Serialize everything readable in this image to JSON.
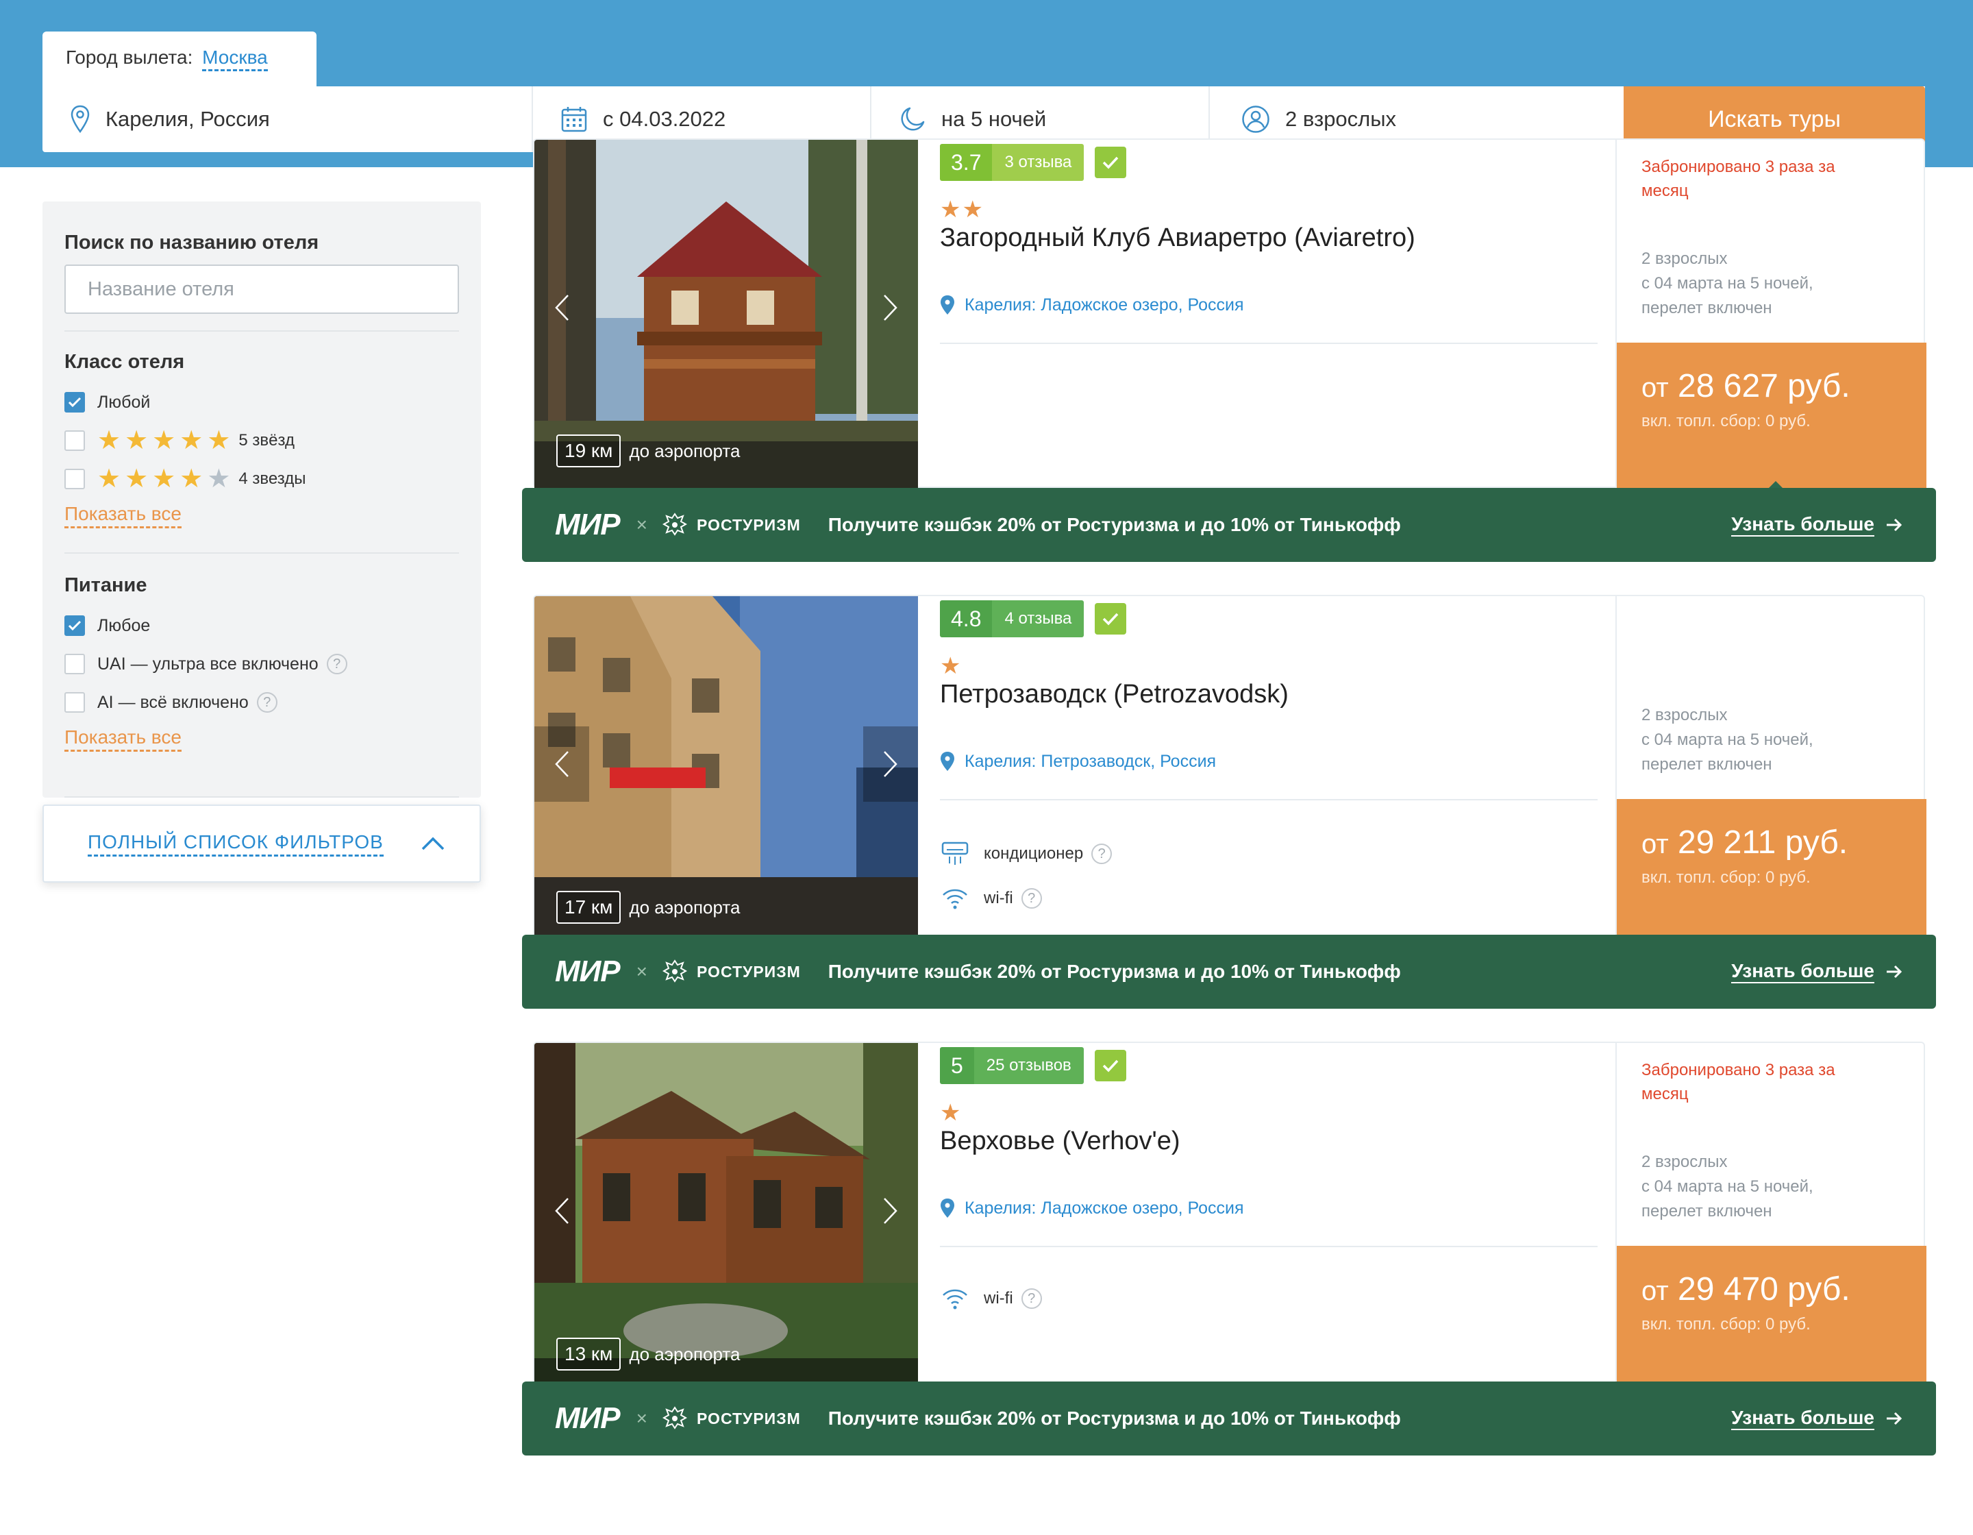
{
  "header": {
    "departure_label": "Город вылета:",
    "departure_city": "Москва",
    "destination": "Карелия, Россия",
    "date": "с 04.03.2022",
    "nights": "на 5 ночей",
    "people": "2 взрослых",
    "search_button": "Искать туры"
  },
  "filters": {
    "search_title": "Поиск по названию отеля",
    "search_placeholder": "Название отеля",
    "class_title": "Класс отеля",
    "class_options": [
      {
        "label": "Любой",
        "checked": true
      },
      {
        "label": "5 звёзд",
        "stars": 5,
        "checked": false
      },
      {
        "label": "4 звезды",
        "stars": 4,
        "checked": false
      }
    ],
    "class_show_all": "Показать все",
    "meal_title": "Питание",
    "meal_options": [
      {
        "label": "Любое",
        "checked": true
      },
      {
        "label": "UAI — ультра все включено",
        "checked": false
      },
      {
        "label": "AI — всё включено",
        "checked": false
      }
    ],
    "meal_show_all": "Показать все",
    "full_list": "ПОЛНЫЙ СПИСОК ФИЛЬТРОВ"
  },
  "hotels": [
    {
      "score": "3.7",
      "reviews": "3 отзыва",
      "stars": "★★",
      "name": "Загородный Клуб Авиаретро (Aviaretro)",
      "location": "Карелия: Ладожское озеро, Россия",
      "distance_km": "19 км",
      "distance_label": "до аэропорта",
      "booked": "Забронировано 3 раза за месяц",
      "details": [
        "2 взрослых",
        "с 04 марта на 5 ночей,",
        "перелет включен"
      ],
      "price_prefix": "от",
      "price": "28 627 руб.",
      "fee": "вкл. топл. сбор: 0 руб."
    },
    {
      "score": "4.8",
      "reviews": "4 отзыва",
      "stars": "★",
      "name": "Петрозаводск (Petrozavodsk)",
      "location": "Карелия: Петрозаводск, Россия",
      "distance_km": "17 км",
      "distance_label": "до аэропорта",
      "amenities": [
        "кондиционер",
        "wi-fi"
      ],
      "details": [
        "2 взрослых",
        "с 04 марта на 5 ночей,",
        "перелет включен"
      ],
      "price_prefix": "от",
      "price": "29 211 руб.",
      "fee": "вкл. топл. сбор: 0 руб."
    },
    {
      "score": "5",
      "reviews": "25 отзывов",
      "stars": "★",
      "name": "Верховье (Verhov'e)",
      "location": "Карелия: Ладожское озеро, Россия",
      "distance_km": "13 км",
      "distance_label": "до аэропорта",
      "amenities": [
        "wi-fi"
      ],
      "booked": "Забронировано 3 раза за месяц",
      "details": [
        "2 взрослых",
        "с 04 марта на 5 ночей,",
        "перелет включен"
      ],
      "price_prefix": "от",
      "price": "29 470 руб.",
      "fee": "вкл. топл. сбор: 0 руб."
    }
  ],
  "promo": {
    "mir": "МИР",
    "x": "×",
    "rosturizm": "РОСТУРИЗМ",
    "message": "Получите кэшбэк 20% от Ростуризма и до 10% от Тинькофф",
    "more": "Узнать больше"
  },
  "colors": {
    "header_bg": "#4a9fd0",
    "accent_orange": "#e9954a",
    "promo_green": "#2c6448",
    "link_blue": "#2a8bd0",
    "rating_green": "#80c034",
    "booked_red": "#e0482d"
  }
}
